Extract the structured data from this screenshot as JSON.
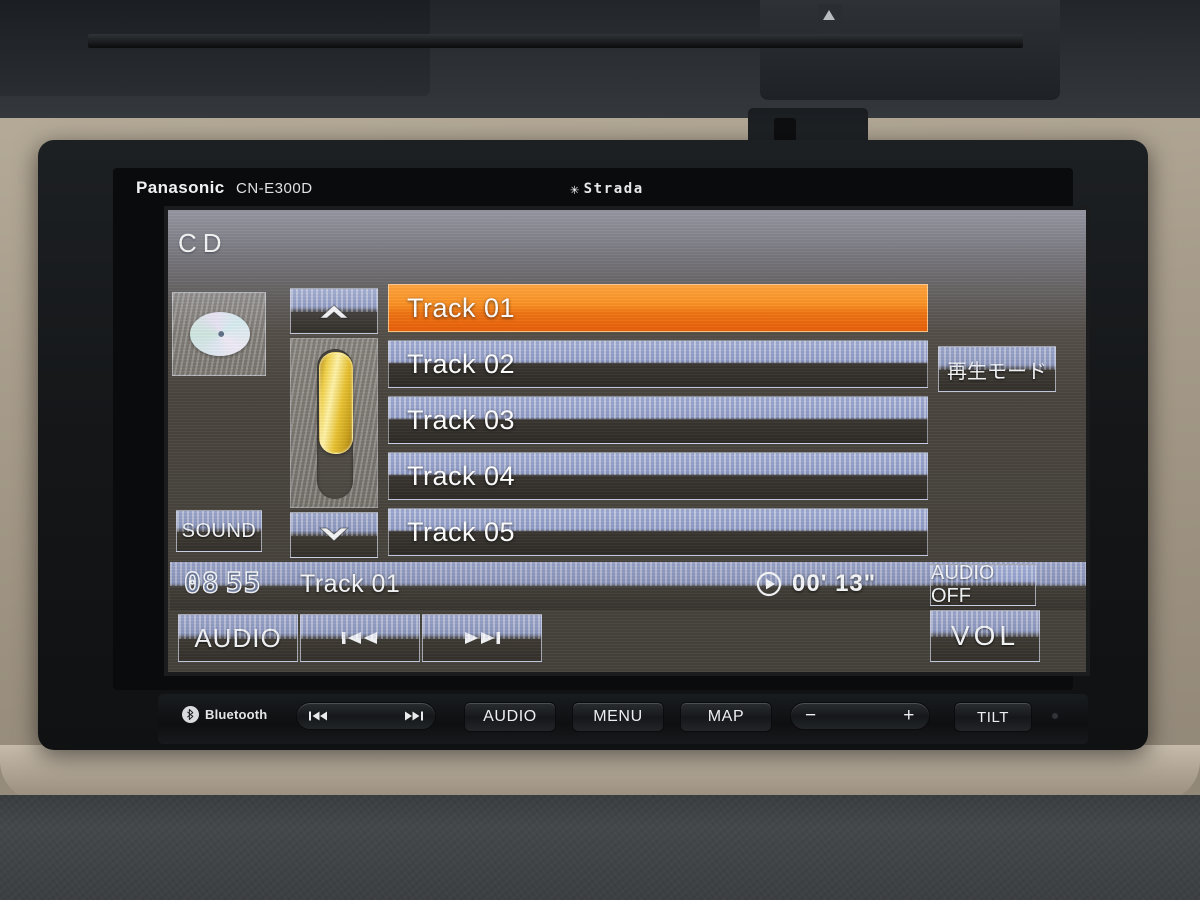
{
  "device": {
    "brand": "Panasonic",
    "model": "CN-E300D",
    "series": "Strada",
    "series_icon": "asterisk-star-icon"
  },
  "screen": {
    "source_label": "CD",
    "disc_icon": "compact-disc-icon",
    "sound_button": "SOUND",
    "scroll": {
      "up_icon": "chevron-up-icon",
      "down_icon": "chevron-down-icon",
      "thumb_color": "#f2d24a"
    },
    "track_list": [
      {
        "label": "Track 01",
        "selected": true
      },
      {
        "label": "Track 02",
        "selected": false
      },
      {
        "label": "Track 03",
        "selected": false
      },
      {
        "label": "Track 04",
        "selected": false
      },
      {
        "label": "Track 05",
        "selected": false
      }
    ],
    "play_mode_button": "再生モード",
    "status": {
      "clock_hours": "08",
      "clock_minutes": "55",
      "now_playing": "Track 01",
      "play_icon": "play-circle-icon",
      "elapsed_time": "00' 13\"",
      "audio_off_button": "AUDIO OFF"
    },
    "controls": {
      "audio_button": "AUDIO",
      "prev_icon": "skip-previous-icon",
      "next_icon": "skip-next-icon",
      "vol_button": "VOL"
    },
    "colors": {
      "selected_row": "#fb8c12",
      "button_face": "#9ba7d4",
      "screen_base": "#4a453f"
    }
  },
  "hardware": {
    "bluetooth_label": "Bluetooth",
    "bluetooth_icon": "bluetooth-icon",
    "skip_prev_icon": "skip-previous-icon",
    "skip_next_icon": "skip-next-icon",
    "audio_button": "AUDIO",
    "menu_button": "MENU",
    "map_button": "MAP",
    "volume_down": "−",
    "volume_up": "+",
    "tilt_button": "TILT"
  }
}
